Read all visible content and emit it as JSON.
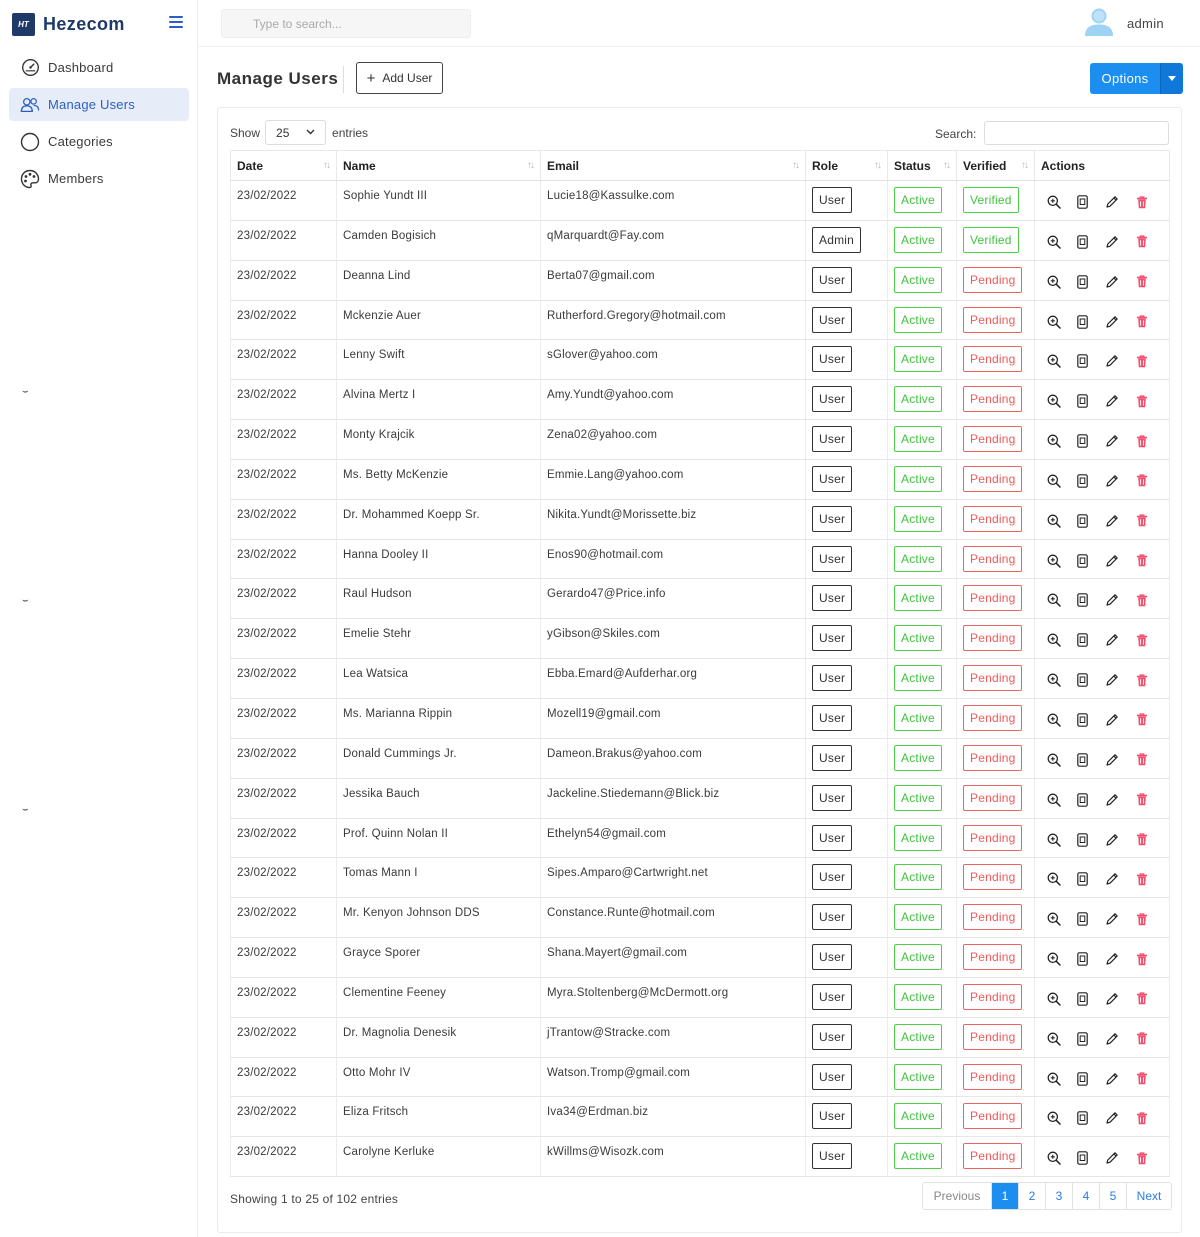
{
  "brand": {
    "logo_text": "HT",
    "name": "Hezecom"
  },
  "sidebar": {
    "items": [
      {
        "label": "Dashboard",
        "icon": "gauge-icon"
      },
      {
        "label": "Manage Users",
        "icon": "users-icon"
      },
      {
        "label": "Categories",
        "icon": "circle-icon"
      },
      {
        "label": "Members",
        "icon": "palette-icon"
      }
    ],
    "marks": [
      "⌣",
      "⌣",
      "⌣"
    ]
  },
  "topbar": {
    "search_placeholder": "Type to search...",
    "user_name": "admin"
  },
  "header": {
    "title": "Manage Users",
    "add_user_label": "Add User",
    "options_label": "Options"
  },
  "table_controls": {
    "show_label": "Show",
    "page_length": "25",
    "entries_label": "entries",
    "search_label": "Search:"
  },
  "columns": [
    "Date",
    "Name",
    "Email",
    "Role",
    "Status",
    "Verified",
    "Actions"
  ],
  "rows": [
    {
      "date": "23/02/2022",
      "name": "Sophie Yundt III",
      "email": "Lucie18@Kassulke.com",
      "role": "User",
      "status": "Active",
      "verified": "Verified"
    },
    {
      "date": "23/02/2022",
      "name": "Camden Bogisich",
      "email": "qMarquardt@Fay.com",
      "role": "Admin",
      "status": "Active",
      "verified": "Verified"
    },
    {
      "date": "23/02/2022",
      "name": "Deanna Lind",
      "email": "Berta07@gmail.com",
      "role": "User",
      "status": "Active",
      "verified": "Pending"
    },
    {
      "date": "23/02/2022",
      "name": "Mckenzie Auer",
      "email": "Rutherford.Gregory@hotmail.com",
      "role": "User",
      "status": "Active",
      "verified": "Pending"
    },
    {
      "date": "23/02/2022",
      "name": "Lenny Swift",
      "email": "sGlover@yahoo.com",
      "role": "User",
      "status": "Active",
      "verified": "Pending"
    },
    {
      "date": "23/02/2022",
      "name": "Alvina Mertz I",
      "email": "Amy.Yundt@yahoo.com",
      "role": "User",
      "status": "Active",
      "verified": "Pending"
    },
    {
      "date": "23/02/2022",
      "name": "Monty Krajcik",
      "email": "Zena02@yahoo.com",
      "role": "User",
      "status": "Active",
      "verified": "Pending"
    },
    {
      "date": "23/02/2022",
      "name": "Ms. Betty McKenzie",
      "email": "Emmie.Lang@yahoo.com",
      "role": "User",
      "status": "Active",
      "verified": "Pending"
    },
    {
      "date": "23/02/2022",
      "name": "Dr. Mohammed Koepp Sr.",
      "email": "Nikita.Yundt@Morissette.biz",
      "role": "User",
      "status": "Active",
      "verified": "Pending"
    },
    {
      "date": "23/02/2022",
      "name": "Hanna Dooley II",
      "email": "Enos90@hotmail.com",
      "role": "User",
      "status": "Active",
      "verified": "Pending"
    },
    {
      "date": "23/02/2022",
      "name": "Raul Hudson",
      "email": "Gerardo47@Price.info",
      "role": "User",
      "status": "Active",
      "verified": "Pending"
    },
    {
      "date": "23/02/2022",
      "name": "Emelie Stehr",
      "email": "yGibson@Skiles.com",
      "role": "User",
      "status": "Active",
      "verified": "Pending"
    },
    {
      "date": "23/02/2022",
      "name": "Lea Watsica",
      "email": "Ebba.Emard@Aufderhar.org",
      "role": "User",
      "status": "Active",
      "verified": "Pending"
    },
    {
      "date": "23/02/2022",
      "name": "Ms. Marianna Rippin",
      "email": "Mozell19@gmail.com",
      "role": "User",
      "status": "Active",
      "verified": "Pending"
    },
    {
      "date": "23/02/2022",
      "name": "Donald Cummings Jr.",
      "email": "Dameon.Brakus@yahoo.com",
      "role": "User",
      "status": "Active",
      "verified": "Pending"
    },
    {
      "date": "23/02/2022",
      "name": "Jessika Bauch",
      "email": "Jackeline.Stiedemann@Blick.biz",
      "role": "User",
      "status": "Active",
      "verified": "Pending"
    },
    {
      "date": "23/02/2022",
      "name": "Prof. Quinn Nolan II",
      "email": "Ethelyn54@gmail.com",
      "role": "User",
      "status": "Active",
      "verified": "Pending"
    },
    {
      "date": "23/02/2022",
      "name": "Tomas Mann I",
      "email": "Sipes.Amparo@Cartwright.net",
      "role": "User",
      "status": "Active",
      "verified": "Pending"
    },
    {
      "date": "23/02/2022",
      "name": "Mr. Kenyon Johnson DDS",
      "email": "Constance.Runte@hotmail.com",
      "role": "User",
      "status": "Active",
      "verified": "Pending"
    },
    {
      "date": "23/02/2022",
      "name": "Grayce Sporer",
      "email": "Shana.Mayert@gmail.com",
      "role": "User",
      "status": "Active",
      "verified": "Pending"
    },
    {
      "date": "23/02/2022",
      "name": "Clementine Feeney",
      "email": "Myra.Stoltenberg@McDermott.org",
      "role": "User",
      "status": "Active",
      "verified": "Pending"
    },
    {
      "date": "23/02/2022",
      "name": "Dr. Magnolia Denesik",
      "email": "jTrantow@Stracke.com",
      "role": "User",
      "status": "Active",
      "verified": "Pending"
    },
    {
      "date": "23/02/2022",
      "name": "Otto Mohr IV",
      "email": "Watson.Tromp@gmail.com",
      "role": "User",
      "status": "Active",
      "verified": "Pending"
    },
    {
      "date": "23/02/2022",
      "name": "Eliza Fritsch",
      "email": "Iva34@Erdman.biz",
      "role": "User",
      "status": "Active",
      "verified": "Pending"
    },
    {
      "date": "23/02/2022",
      "name": "Carolyne Kerluke",
      "email": "kWillms@Wisozk.com",
      "role": "User",
      "status": "Active",
      "verified": "Pending"
    }
  ],
  "row_actions": [
    "zoom-in-icon",
    "document-icon",
    "pencil-icon",
    "trash-icon"
  ],
  "footer": {
    "info": "Showing 1 to 25 of 102 entries",
    "previous": "Previous",
    "pages": [
      "1",
      "2",
      "3",
      "4",
      "5"
    ],
    "current_page": "1",
    "next": "Next"
  },
  "colors": {
    "accent": "#1c8ef0",
    "brand": "#1f3a68",
    "active": "#3ec43e",
    "pending": "#f05a5a",
    "delete": "#f0506e"
  }
}
